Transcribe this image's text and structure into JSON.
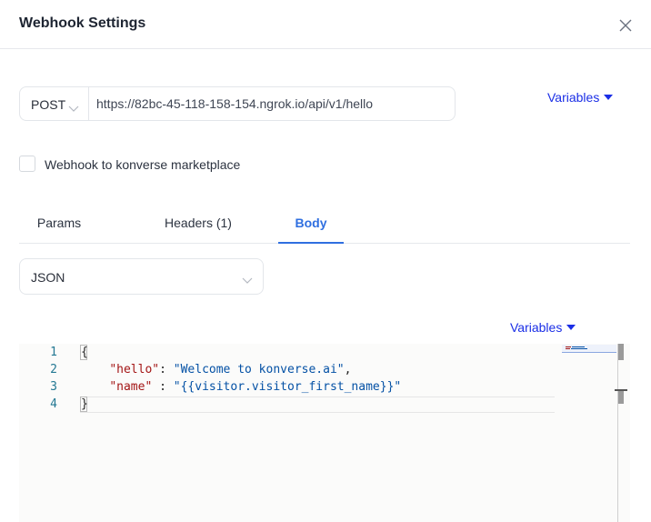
{
  "dialog": {
    "title": "Webhook Settings"
  },
  "request": {
    "method": "POST",
    "url": "https://82bc-45-118-158-154.ngrok.io/api/v1/hello"
  },
  "variables_label": "Variables",
  "marketplace_checkbox": {
    "label": "Webhook to konverse marketplace",
    "checked": false
  },
  "tabs": [
    {
      "label": "Params",
      "active": false
    },
    {
      "label": "Headers (1)",
      "active": false
    },
    {
      "label": "Body",
      "active": true
    }
  ],
  "body": {
    "format": "JSON",
    "variables_label": "Variables",
    "line_numbers": [
      "1",
      "2",
      "3",
      "4"
    ],
    "code": {
      "open_brace": "{",
      "line2_key": "\"hello\"",
      "line2_sep": ": ",
      "line2_value": "\"Welcome to konverse.ai\"",
      "line2_end": ",",
      "line3_key": "\"name\"",
      "line3_sep": " : ",
      "line3_value": "\"{{visitor.visitor_first_name}}\"",
      "close_brace": "}"
    }
  },
  "colors": {
    "link": "#1a2ee6",
    "active_tab": "#2f6fe0",
    "json_key": "#a31515",
    "json_string": "#0451a5",
    "line_number": "#237893"
  },
  "icons": {
    "close": "close-icon",
    "dropdown": "chevron-down-icon",
    "variables": "caret-down-icon"
  }
}
